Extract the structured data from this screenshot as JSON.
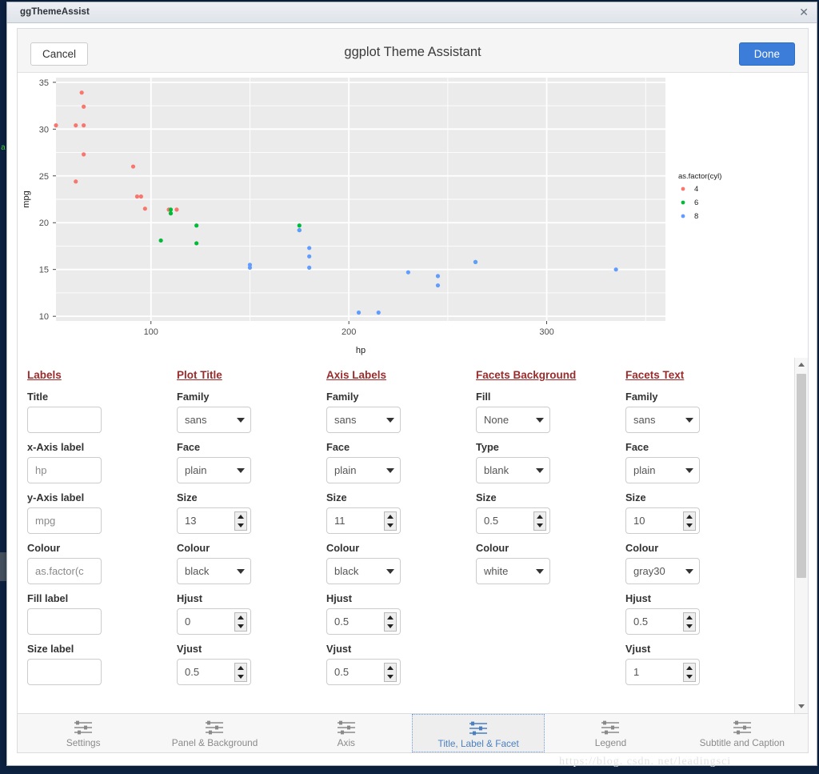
{
  "window": {
    "title": "ggThemeAssist",
    "close_icon": "close-icon"
  },
  "header": {
    "cancel_label": "Cancel",
    "title": "ggplot Theme Assistant",
    "done_label": "Done",
    "accent_color": "#3b7dd8"
  },
  "watermark": "https://blog. csdn. net/leadingsci",
  "chart_data": {
    "type": "scatter",
    "title": "",
    "xlabel": "hp",
    "ylabel": "mpg",
    "xlim": [
      52,
      360
    ],
    "ylim": [
      9.5,
      35.5
    ],
    "xticks": [
      100,
      200,
      300
    ],
    "yticks": [
      10,
      15,
      20,
      25,
      30,
      35
    ],
    "grid": true,
    "panel_fill": "#ebebeb",
    "grid_color": "#ffffff",
    "legend": {
      "title": "as.factor(cyl)",
      "position": "right",
      "entries": [
        {
          "label": "4",
          "color": "#f8766d"
        },
        {
          "label": "6",
          "color": "#00ba38"
        },
        {
          "label": "8",
          "color": "#619cff"
        }
      ]
    },
    "series": [
      {
        "name": "4",
        "color": "#f8766d",
        "points": [
          [
            62,
            30.4
          ],
          [
            65,
            33.9
          ],
          [
            66,
            32.4
          ],
          [
            66,
            30.4
          ],
          [
            91,
            26.0
          ],
          [
            93,
            22.8
          ],
          [
            95,
            22.8
          ],
          [
            97,
            21.5
          ],
          [
            109,
            21.4
          ],
          [
            113,
            21.4
          ],
          [
            66,
            27.3
          ],
          [
            52,
            30.4
          ],
          [
            62,
            24.4
          ]
        ]
      },
      {
        "name": "6",
        "color": "#00ba38",
        "points": [
          [
            105,
            18.1
          ],
          [
            110,
            21.0
          ],
          [
            110,
            21.0
          ],
          [
            110,
            21.4
          ],
          [
            123,
            19.7
          ],
          [
            123,
            17.8
          ],
          [
            175,
            19.2
          ],
          [
            175,
            19.7
          ],
          [
            264,
            15.8
          ]
        ]
      },
      {
        "name": "8",
        "color": "#619cff",
        "points": [
          [
            150,
            15.2
          ],
          [
            150,
            15.5
          ],
          [
            175,
            19.2
          ],
          [
            180,
            16.4
          ],
          [
            180,
            17.3
          ],
          [
            180,
            15.2
          ],
          [
            205,
            10.4
          ],
          [
            215,
            10.4
          ],
          [
            230,
            14.7
          ],
          [
            245,
            13.3
          ],
          [
            245,
            14.3
          ],
          [
            264,
            15.8
          ],
          [
            335,
            15.0
          ]
        ]
      }
    ]
  },
  "form": {
    "columns": [
      {
        "heading": "Labels",
        "fields": [
          {
            "label": "Title",
            "kind": "text",
            "value": "",
            "placeholder": ""
          },
          {
            "label": "x-Axis label",
            "kind": "text",
            "value": "hp"
          },
          {
            "label": "y-Axis label",
            "kind": "text",
            "value": "mpg"
          },
          {
            "label": "Colour",
            "kind": "text",
            "value": "as.factor(c"
          },
          {
            "label": "Fill label",
            "kind": "text",
            "value": ""
          },
          {
            "label": "Size label",
            "kind": "text",
            "value": ""
          }
        ]
      },
      {
        "heading": "Plot Title",
        "fields": [
          {
            "label": "Family",
            "kind": "select",
            "value": "sans"
          },
          {
            "label": "Face",
            "kind": "select",
            "value": "plain"
          },
          {
            "label": "Size",
            "kind": "number",
            "value": "13"
          },
          {
            "label": "Colour",
            "kind": "select",
            "value": "black"
          },
          {
            "label": "Hjust",
            "kind": "number",
            "value": "0"
          },
          {
            "label": "Vjust",
            "kind": "number",
            "value": "0.5"
          }
        ]
      },
      {
        "heading": "Axis Labels",
        "fields": [
          {
            "label": "Family",
            "kind": "select",
            "value": "sans"
          },
          {
            "label": "Face",
            "kind": "select",
            "value": "plain"
          },
          {
            "label": "Size",
            "kind": "number",
            "value": "11"
          },
          {
            "label": "Colour",
            "kind": "select",
            "value": "black"
          },
          {
            "label": "Hjust",
            "kind": "number",
            "value": "0.5"
          },
          {
            "label": "Vjust",
            "kind": "number",
            "value": "0.5"
          }
        ]
      },
      {
        "heading": "Facets Background",
        "fields": [
          {
            "label": "Fill",
            "kind": "select",
            "value": "None"
          },
          {
            "label": "Type",
            "kind": "select",
            "value": "blank"
          },
          {
            "label": "Size",
            "kind": "number",
            "value": "0.5"
          },
          {
            "label": "Colour",
            "kind": "select",
            "value": "white"
          }
        ]
      },
      {
        "heading": "Facets Text",
        "fields": [
          {
            "label": "Family",
            "kind": "select",
            "value": "sans"
          },
          {
            "label": "Face",
            "kind": "select",
            "value": "plain"
          },
          {
            "label": "Size",
            "kind": "number",
            "value": "10"
          },
          {
            "label": "Colour",
            "kind": "select",
            "value": "gray30"
          },
          {
            "label": "Hjust",
            "kind": "number",
            "value": "0.5"
          },
          {
            "label": "Vjust",
            "kind": "number",
            "value": "1"
          }
        ]
      }
    ]
  },
  "tabs": [
    {
      "label": "Settings",
      "active": false
    },
    {
      "label": "Panel & Background",
      "active": false
    },
    {
      "label": "Axis",
      "active": false
    },
    {
      "label": "Title, Label & Facet",
      "active": true
    },
    {
      "label": "Legend",
      "active": false
    },
    {
      "label": "Subtitle and Caption",
      "active": false
    }
  ]
}
